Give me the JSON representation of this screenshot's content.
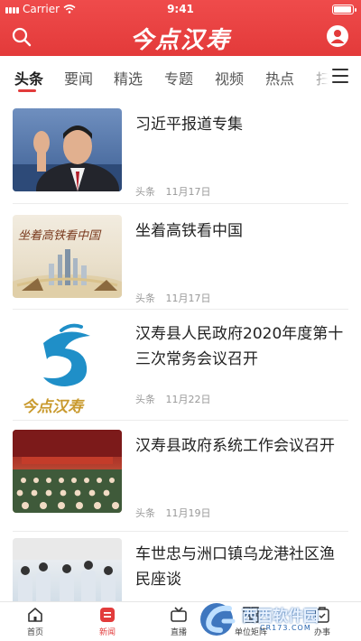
{
  "status_bar": {
    "carrier": "Carrier",
    "time": "9:41"
  },
  "header": {
    "logo": "今点汉寿",
    "search_icon": "search-icon",
    "user_icon": "user-icon"
  },
  "tabs": [
    "头条",
    "要闻",
    "精选",
    "专题",
    "视频",
    "热点",
    "扫"
  ],
  "active_tab": "头条",
  "news": [
    {
      "title": "习近平报道专集",
      "source": "头条",
      "date": "11月17日"
    },
    {
      "title": "坐着高铁看中国",
      "source": "头条",
      "date": "11月17日",
      "thumb_text": "坐着高铁看中国"
    },
    {
      "title": "汉寿县人民政府2020年度第十三次常务会议召开",
      "source": "头条",
      "date": "11月22日",
      "thumb_text": "今点汉寿"
    },
    {
      "title": "汉寿县政府系统工作会议召开",
      "source": "头条",
      "date": "11月19日"
    },
    {
      "title": "车世忠与洲口镇乌龙港社区渔民座谈",
      "source": "",
      "date": ""
    }
  ],
  "bottom_nav": [
    {
      "label": "首页",
      "icon": "home-icon"
    },
    {
      "label": "新闻",
      "icon": "news-icon"
    },
    {
      "label": "直播",
      "icon": "live-icon"
    },
    {
      "label": "单位矩阵",
      "icon": "matrix-icon"
    },
    {
      "label": "办事",
      "icon": "service-icon"
    }
  ],
  "watermark": {
    "text": "西西软件园",
    "sub": "CR173.COM"
  },
  "colors": {
    "brand_red": "#e33a3a",
    "accent": "#e23b3b"
  }
}
